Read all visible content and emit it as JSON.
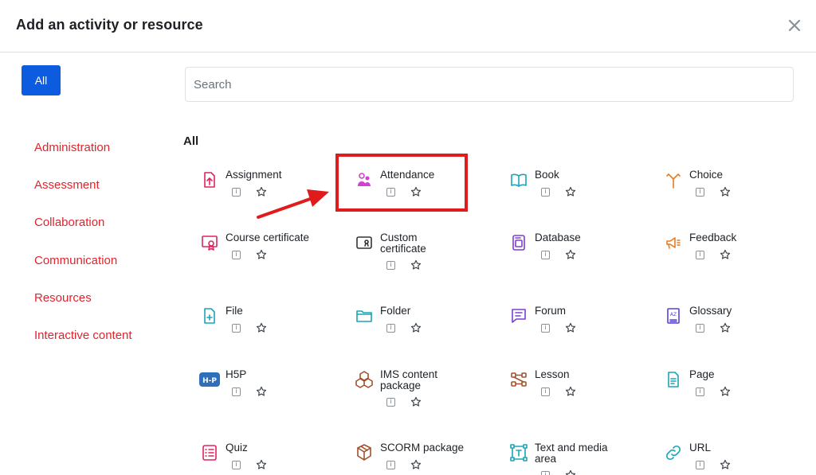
{
  "dialog": {
    "title": "Add an activity or resource"
  },
  "search": {
    "placeholder": "Search"
  },
  "filter": {
    "all_label": "All"
  },
  "categories": [
    "Administration",
    "Assessment",
    "Collaboration",
    "Communication",
    "Resources",
    "Interactive content"
  ],
  "section": {
    "title": "All"
  },
  "items": [
    {
      "name": "Assignment",
      "icon": "assignment-icon",
      "color": "#e0245e"
    },
    {
      "name": "Attendance",
      "icon": "attendance-icon",
      "color": "#d43fd6"
    },
    {
      "name": "Book",
      "icon": "book-icon",
      "color": "#1ba5b6"
    },
    {
      "name": "Choice",
      "icon": "choice-icon",
      "color": "#e87b20"
    },
    {
      "name": "Course certificate",
      "icon": "certificate-icon",
      "color": "#e0245e"
    },
    {
      "name": "Custom certificate",
      "icon": "custom-certificate-icon",
      "color": "#333333"
    },
    {
      "name": "Database",
      "icon": "database-icon",
      "color": "#7b3fd6"
    },
    {
      "name": "Feedback",
      "icon": "feedback-icon",
      "color": "#e87b20"
    },
    {
      "name": "File",
      "icon": "file-icon",
      "color": "#1ba5b6"
    },
    {
      "name": "Folder",
      "icon": "folder-icon",
      "color": "#1ba5b6"
    },
    {
      "name": "Forum",
      "icon": "forum-icon",
      "color": "#7b3fd6"
    },
    {
      "name": "Glossary",
      "icon": "glossary-icon",
      "color": "#5b3fd6"
    },
    {
      "name": "H5P",
      "icon": "h5p-icon",
      "color": "#2f6fba"
    },
    {
      "name": "IMS content package",
      "icon": "ims-package-icon",
      "color": "#a0522d"
    },
    {
      "name": "Lesson",
      "icon": "lesson-icon",
      "color": "#a0522d"
    },
    {
      "name": "Page",
      "icon": "page-icon",
      "color": "#1ba5b6"
    },
    {
      "name": "Quiz",
      "icon": "quiz-icon",
      "color": "#e0245e"
    },
    {
      "name": "SCORM package",
      "icon": "scorm-icon",
      "color": "#a0522d"
    },
    {
      "name": "Text and media area",
      "icon": "text-media-icon",
      "color": "#1ba5b6"
    },
    {
      "name": "URL",
      "icon": "url-icon",
      "color": "#1ba5b6"
    }
  ],
  "info_glyph": "i",
  "colors": {
    "accent": "#0d5ce0",
    "category": "#e0242e",
    "annotation": "#e01b1b"
  }
}
